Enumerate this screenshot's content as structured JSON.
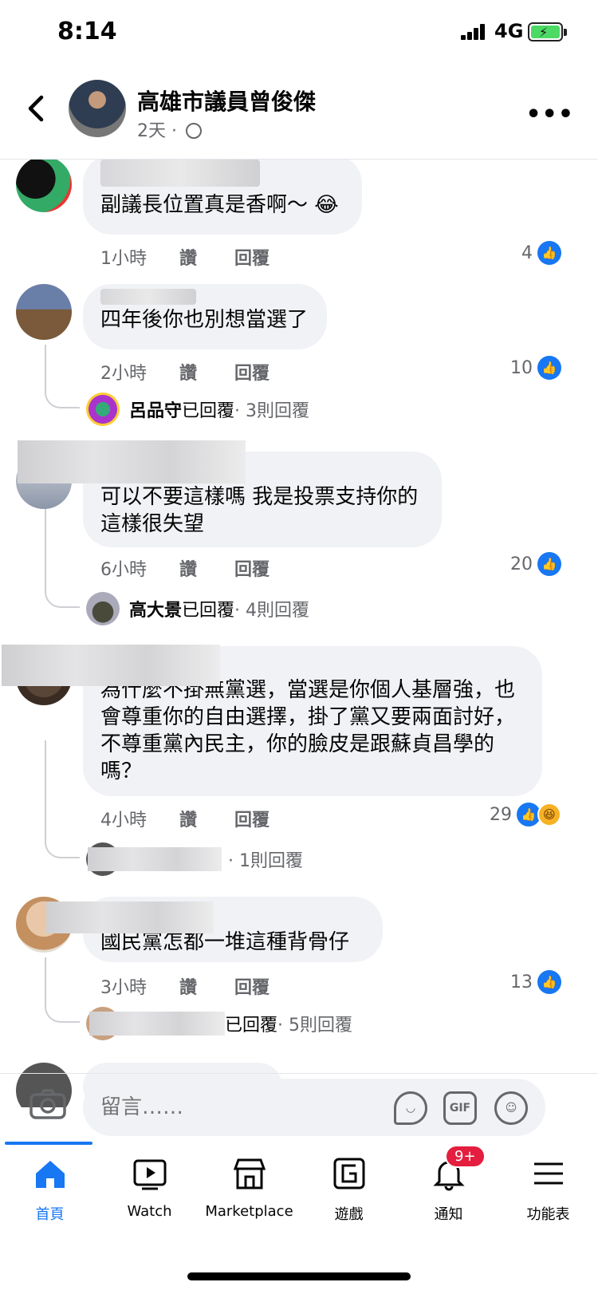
{
  "status_bar": {
    "time": "8:14",
    "network": "4G"
  },
  "header": {
    "page_name": "高雄市議員曾俊傑",
    "post_age": "2天",
    "dot": "·"
  },
  "comments": [
    {
      "text": "副議長位置真是香啊～ 😂",
      "time": "1小時",
      "like_action": "讚",
      "reply_action": "回覆",
      "like_count": "4"
    },
    {
      "text": "四年後你也別想當選了",
      "time": "2小時",
      "like_action": "讚",
      "reply_action": "回覆",
      "like_count": "10",
      "reply_summary": {
        "name": "呂品守",
        "verb": "已回覆",
        "count": "· 3則回覆"
      }
    },
    {
      "text": "可以不要這樣嗎 我是投票支持你的\n這樣很失望",
      "time": "6小時",
      "like_action": "讚",
      "reply_action": "回覆",
      "like_count": "20",
      "reply_summary": {
        "name": "高大景",
        "verb": "已回覆",
        "count": "· 4則回覆"
      }
    },
    {
      "text": "為什麼不掛無黨選，當選是你個人基層強，也\n會尊重你的自由選擇，掛了黨又要兩面討好，\n不尊重黨內民主，你的臉皮是跟蘇貞昌學的\n嗎？",
      "time": "4小時",
      "like_action": "讚",
      "reply_action": "回覆",
      "like_count": "29",
      "reply_summary": {
        "name": "",
        "verb": "",
        "count": "· 1則回覆"
      }
    },
    {
      "text": "國民黨怎都一堆這種背骨仔",
      "time": "3小時",
      "like_action": "讚",
      "reply_action": "回覆",
      "like_count": "13",
      "reply_summary": {
        "name": "",
        "verb": "已回覆",
        "count": "· 5則回覆"
      }
    }
  ],
  "composer": {
    "placeholder": "留言……",
    "gif_label": "GIF"
  },
  "nav": {
    "tabs": [
      {
        "label": "首頁",
        "icon": "home-icon"
      },
      {
        "label": "Watch",
        "icon": "watch-icon"
      },
      {
        "label": "Marketplace",
        "icon": "marketplace-icon"
      },
      {
        "label": "遊戲",
        "icon": "gaming-icon"
      },
      {
        "label": "通知",
        "icon": "bell-icon"
      },
      {
        "label": "功能表",
        "icon": "menu-icon"
      }
    ],
    "notification_badge": "9+"
  },
  "colors": {
    "accent": "#1877f2",
    "bubble": "#f0f2f5",
    "meta": "#65676b",
    "badge": "#e41e3f"
  }
}
